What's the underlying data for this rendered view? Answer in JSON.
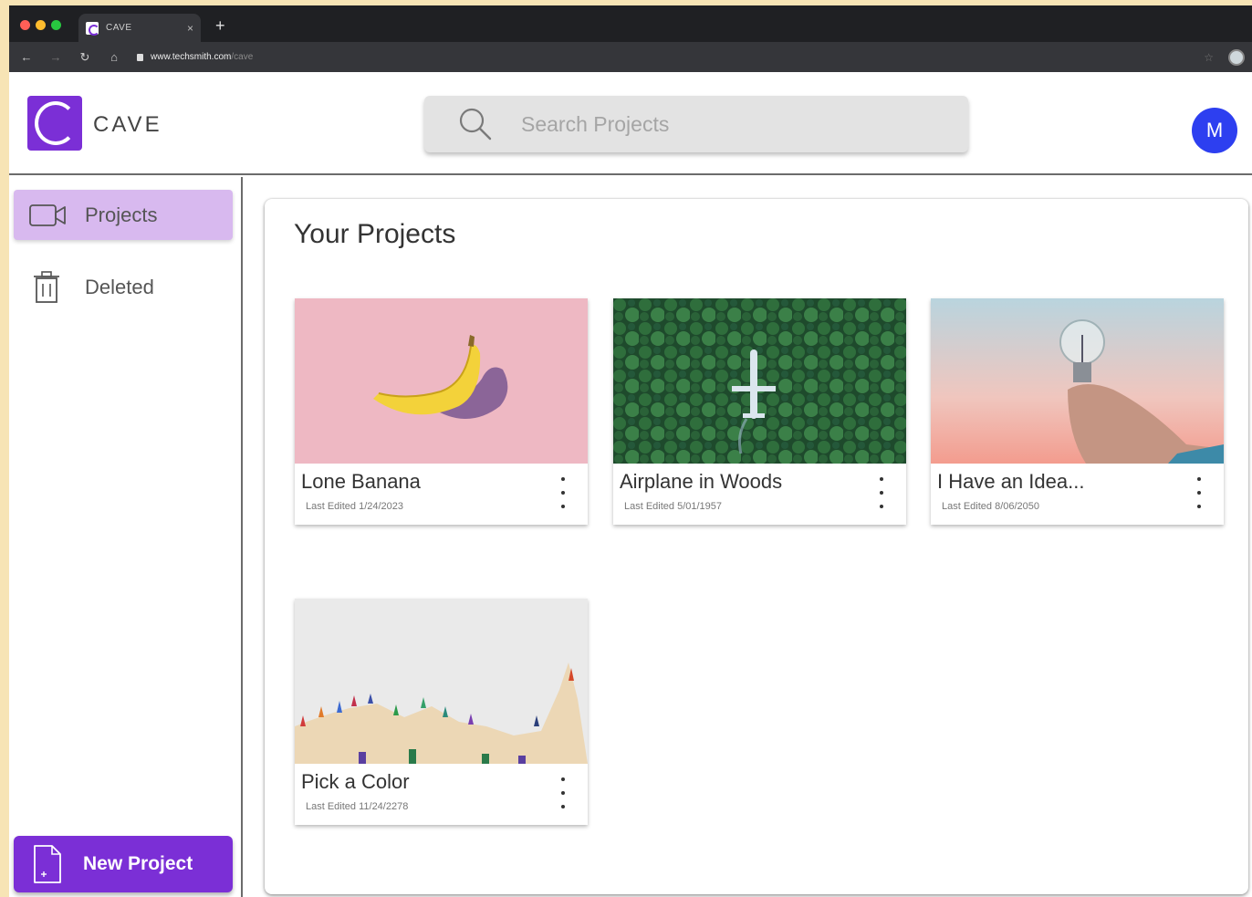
{
  "browser": {
    "tab_title": "CAVE",
    "tab_close": "×",
    "new_tab": "+",
    "url_host": "www.techsmith.com",
    "url_path": "/cave"
  },
  "header": {
    "brand": "CAVE",
    "search_placeholder": "Search Projects",
    "avatar_initial": "M"
  },
  "sidebar": {
    "items": [
      {
        "label": "Projects",
        "icon": "video-camera-icon",
        "active": true
      },
      {
        "label": "Deleted",
        "icon": "trash-icon",
        "active": false
      }
    ],
    "new_project_label": "New Project"
  },
  "main": {
    "title": "Your Projects",
    "projects": [
      {
        "title": "Lone Banana",
        "date": "Last Edited 1/24/2023"
      },
      {
        "title": "Airplane in Woods",
        "date": "Last Edited 5/01/1957"
      },
      {
        "title": "I Have an Idea...",
        "date": "Last Edited 8/06/2050"
      },
      {
        "title": "Pick a Color",
        "date": "Last Edited 11/24/2278"
      }
    ]
  },
  "colors": {
    "accent": "#7b2fd6",
    "active_item": "#d8b9ef",
    "avatar": "#2d3ff0",
    "desktop": "#f7e4b5"
  }
}
